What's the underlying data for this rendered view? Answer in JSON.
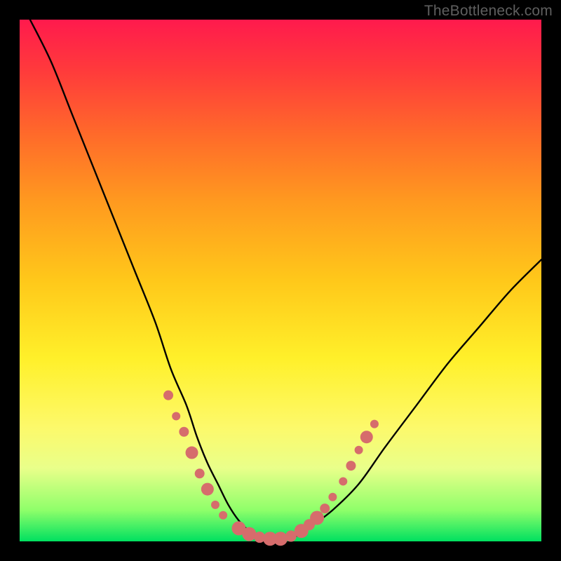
{
  "watermark": "TheBottleneck.com",
  "colors": {
    "frame": "#000000",
    "gradient_top": "#ff1a4d",
    "gradient_bottom": "#00e060",
    "curve_stroke": "#000000",
    "dot_fill": "#d66c6c"
  },
  "chart_data": {
    "type": "line",
    "title": "",
    "xlabel": "",
    "ylabel": "",
    "xlim": [
      0,
      100
    ],
    "ylim": [
      0,
      100
    ],
    "series": [
      {
        "name": "bottleneck-curve",
        "x": [
          2,
          6,
          10,
          14,
          18,
          22,
          26,
          29,
          32,
          34,
          36,
          38,
          40,
          42,
          44,
          46,
          48,
          50,
          53,
          56,
          60,
          65,
          70,
          76,
          82,
          88,
          94,
          100
        ],
        "y": [
          100,
          92,
          82,
          72,
          62,
          52,
          42,
          33,
          26,
          20,
          15,
          11,
          7,
          4,
          2,
          1,
          0,
          0,
          1,
          3,
          6,
          11,
          18,
          26,
          34,
          41,
          48,
          54
        ]
      }
    ],
    "markers": [
      {
        "x": 28.5,
        "y": 28,
        "r": 7
      },
      {
        "x": 30.0,
        "y": 24,
        "r": 6
      },
      {
        "x": 31.5,
        "y": 21,
        "r": 7
      },
      {
        "x": 33.0,
        "y": 17,
        "r": 9
      },
      {
        "x": 34.5,
        "y": 13,
        "r": 7
      },
      {
        "x": 36.0,
        "y": 10,
        "r": 9
      },
      {
        "x": 37.5,
        "y": 7,
        "r": 6
      },
      {
        "x": 39.0,
        "y": 5,
        "r": 6
      },
      {
        "x": 42.0,
        "y": 2.5,
        "r": 10
      },
      {
        "x": 44.0,
        "y": 1.4,
        "r": 10
      },
      {
        "x": 46.0,
        "y": 0.8,
        "r": 8
      },
      {
        "x": 48.0,
        "y": 0.5,
        "r": 10
      },
      {
        "x": 50.0,
        "y": 0.5,
        "r": 10
      },
      {
        "x": 52.0,
        "y": 1.0,
        "r": 8
      },
      {
        "x": 54.0,
        "y": 2.0,
        "r": 10
      },
      {
        "x": 55.5,
        "y": 3.2,
        "r": 8
      },
      {
        "x": 57.0,
        "y": 4.5,
        "r": 10
      },
      {
        "x": 58.5,
        "y": 6.3,
        "r": 7
      },
      {
        "x": 60.0,
        "y": 8.5,
        "r": 6
      },
      {
        "x": 62.0,
        "y": 11.5,
        "r": 6
      },
      {
        "x": 63.5,
        "y": 14.5,
        "r": 7
      },
      {
        "x": 65.0,
        "y": 17.5,
        "r": 6
      },
      {
        "x": 66.5,
        "y": 20.0,
        "r": 9
      },
      {
        "x": 68.0,
        "y": 22.5,
        "r": 6
      }
    ]
  }
}
